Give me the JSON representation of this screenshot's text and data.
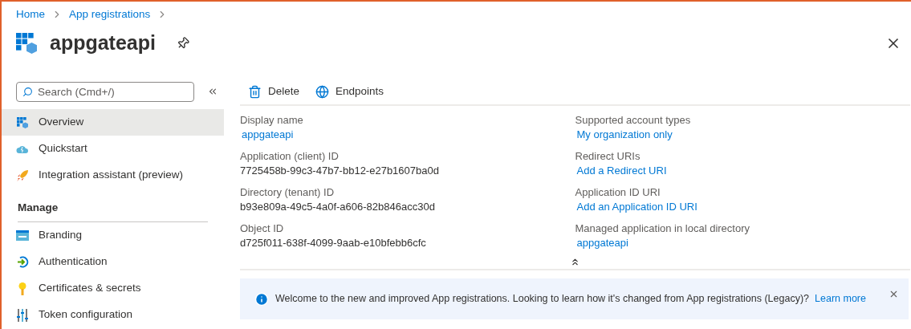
{
  "breadcrumb": [
    "Home",
    "App registrations"
  ],
  "title": "appgateapi",
  "search": {
    "placeholder": "Search (Cmd+/)"
  },
  "sidebar": {
    "items": [
      {
        "label": "Overview",
        "kind": "overview",
        "selected": true
      },
      {
        "label": "Quickstart",
        "kind": "quickstart",
        "selected": false
      },
      {
        "label": "Integration assistant (preview)",
        "kind": "integration",
        "selected": false
      }
    ],
    "sections": [
      {
        "heading": "Manage",
        "items": [
          {
            "label": "Branding",
            "kind": "branding",
            "selected": false
          },
          {
            "label": "Authentication",
            "kind": "authentication",
            "selected": false
          },
          {
            "label": "Certificates & secrets",
            "kind": "certificates",
            "selected": false
          },
          {
            "label": "Token configuration",
            "kind": "token",
            "selected": false
          }
        ]
      }
    ]
  },
  "toolbar": [
    {
      "label": "Delete",
      "kind": "delete"
    },
    {
      "label": "Endpoints",
      "kind": "endpoints"
    }
  ],
  "essentials": {
    "left": [
      {
        "label": "Display name",
        "value": "appgateapi",
        "link": true
      },
      {
        "label": "Application (client) ID",
        "value": "7725458b-99c3-47b7-bb12-e27b1607ba0d",
        "link": false
      },
      {
        "label": "Directory (tenant) ID",
        "value": "b93e809a-49c5-4a0f-a606-82b846acc30d",
        "link": false
      },
      {
        "label": "Object ID",
        "value": "d725f011-638f-4099-9aab-e10bfebb6cfc",
        "link": false
      }
    ],
    "right": [
      {
        "label": "Supported account types",
        "value": "My organization only",
        "link": true
      },
      {
        "label": "Redirect URIs",
        "value": "Add a Redirect URI",
        "link": true
      },
      {
        "label": "Application ID URI",
        "value": "Add an Application ID URI",
        "link": true
      },
      {
        "label": "Managed application in local directory",
        "value": "appgateapi",
        "link": true
      }
    ]
  },
  "banner": {
    "message": "Welcome to the new and improved App registrations. Looking to learn how it's changed from App registrations (Legacy)?",
    "link": "Learn more"
  }
}
